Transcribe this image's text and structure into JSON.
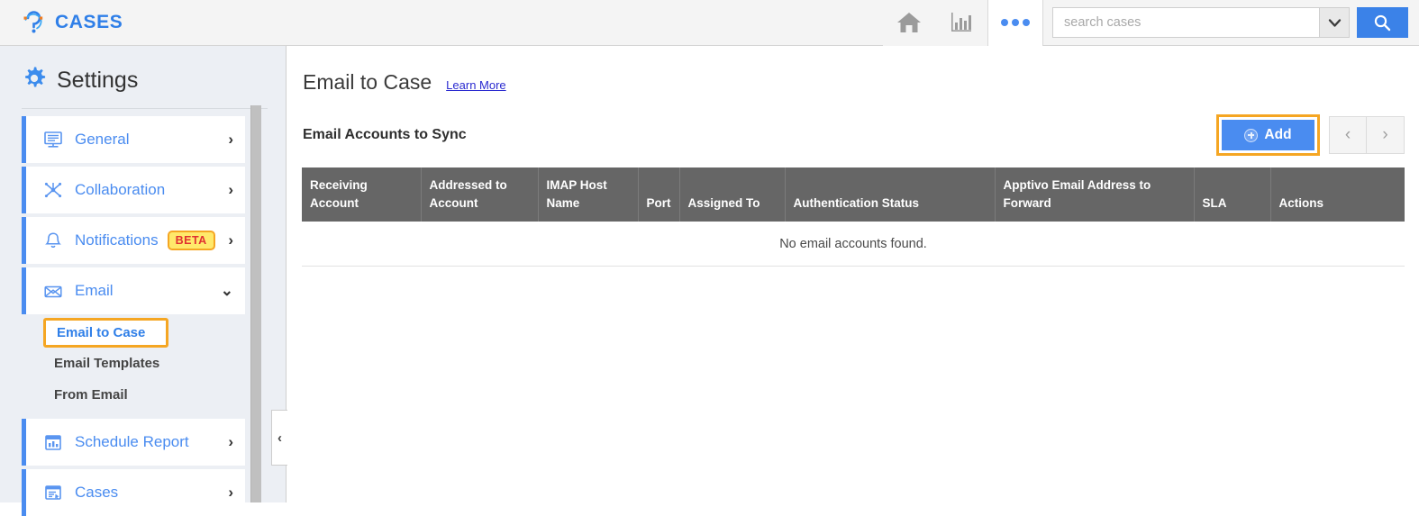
{
  "app": {
    "brand_name": "CASES",
    "logo_icon": "question-mark-ear-logo"
  },
  "topbar": {
    "home_icon": "home-icon",
    "reports_icon": "bar-chart-icon",
    "more_icon": "three-dots-icon",
    "search": {
      "placeholder": "search cases",
      "caret_icon": "chevron-down-icon",
      "search_icon": "magnifier-icon"
    }
  },
  "sidebar": {
    "title": "Settings",
    "gear_icon": "gear-icon",
    "items": [
      {
        "label": "General",
        "icon": "display-monitor-icon",
        "chevron": "›",
        "badge": null
      },
      {
        "label": "Collaboration",
        "icon": "network-nodes-icon",
        "chevron": "›",
        "badge": null
      },
      {
        "label": "Notifications",
        "icon": "bell-icon",
        "chevron": "›",
        "badge": "BETA"
      },
      {
        "label": "Email",
        "icon": "envelope-icon",
        "chevron": "⌄",
        "badge": null
      }
    ],
    "sub_items": [
      {
        "label": "Email to Case",
        "active": true
      },
      {
        "label": "Email Templates",
        "active": false
      },
      {
        "label": "From Email",
        "active": false
      }
    ],
    "items_bottom": [
      {
        "label": "Schedule Report",
        "icon": "calendar-chart-icon",
        "chevron": "›"
      },
      {
        "label": "Cases",
        "icon": "case-window-icon",
        "chevron": "›"
      }
    ],
    "collapse_icon": "‹"
  },
  "main": {
    "page_title": "Email to Case",
    "learn_more": "Learn More",
    "section_title": "Email Accounts to Sync",
    "add_label": "Add",
    "add_icon": "plus-circle-icon",
    "prev_icon": "‹",
    "next_icon": "›",
    "table": {
      "columns": [
        "Receiving Account",
        "Addressed to Account",
        "IMAP Host Name",
        "Port",
        "Assigned To",
        "Authentication Status",
        "Apptivo Email Address to Forward",
        "SLA",
        "Actions"
      ],
      "empty_message": "No email accounts found."
    }
  },
  "colors": {
    "accent_blue": "#4a8cf0",
    "highlight_orange": "#f5a623",
    "table_header_gray": "#666666",
    "sidebar_bg": "#eceff4",
    "badge_yellow": "#ffe96b",
    "badge_red": "#e03030"
  }
}
